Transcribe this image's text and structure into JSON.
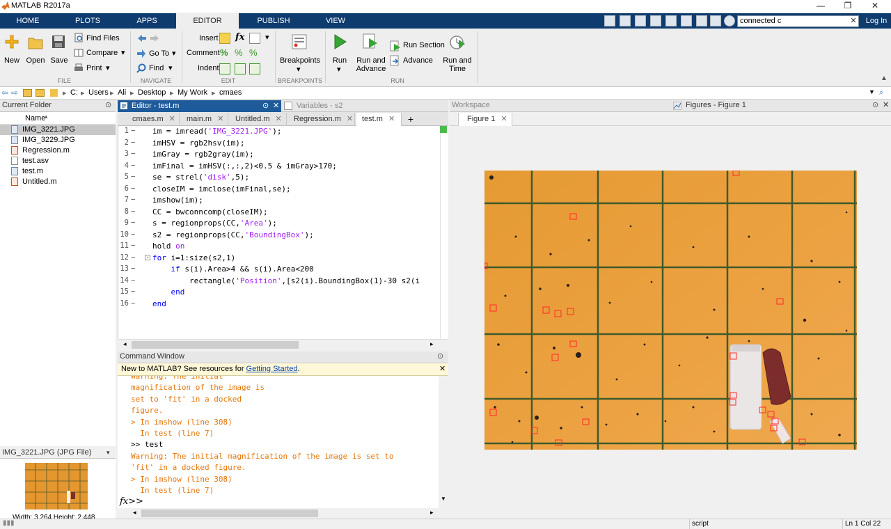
{
  "window": {
    "title": "MATLAB R2017a",
    "minimize": "—",
    "maximize": "❐",
    "close": "✕"
  },
  "ribbon_tabs": [
    "HOME",
    "PLOTS",
    "APPS",
    "EDITOR",
    "PUBLISH",
    "VIEW"
  ],
  "search": {
    "value": "connected c",
    "clear": "✕"
  },
  "login": "Log In",
  "toolstrip": {
    "file": {
      "new": "New",
      "open": "Open",
      "save": "Save",
      "find_files": "Find Files",
      "compare": "Compare",
      "print": "Print",
      "group": "FILE"
    },
    "navigate": {
      "go_to": "Go To",
      "find": "Find",
      "group": "NAVIGATE"
    },
    "edit": {
      "insert": "Insert",
      "comment": "Comment",
      "indent": "Indent",
      "fx": "fx",
      "group": "EDIT"
    },
    "breakpoints": {
      "label": "Breakpoints",
      "group": "BREAKPOINTS"
    },
    "run": {
      "run": "Run",
      "run_and_advance": [
        "Run and",
        "Advance"
      ],
      "run_section": "Run Section",
      "advance": "Advance",
      "run_and_time": [
        "Run and",
        "Time"
      ],
      "group": "RUN"
    }
  },
  "address": {
    "path": [
      "C:",
      "Users",
      "Ali",
      "Desktop",
      "My Work",
      "cmaes"
    ]
  },
  "current_folder": {
    "title": "Current Folder",
    "column": "Name",
    "files": [
      "IMG_3221.JPG",
      "IMG_3229.JPG",
      "Regression.m",
      "test.asv",
      "test.m",
      "Untitled.m"
    ],
    "selected_index": 0,
    "details_title": "IMG_3221.JPG  (JPG File)",
    "details_size": "Width: 3,264 Height: 2,448"
  },
  "editor": {
    "title": "Editor - test.m",
    "variables_title": "Variables - s2",
    "tabs": [
      "cmaes.m",
      "main.m",
      "Untitled.m",
      "Regression.m",
      "test.m"
    ],
    "active_tab": 4,
    "add_tab": "+",
    "lines": [
      [
        {
          "t": "im = imread("
        },
        {
          "t": "'IMG_3221.JPG'",
          "c": "str"
        },
        {
          "t": ");"
        }
      ],
      [
        {
          "t": "imHSV = rgb2hsv(im);"
        }
      ],
      [
        {
          "t": "imGray = rgb2gray(im);"
        }
      ],
      [
        {
          "t": "imFinal = imHSV(:,:,2)<0.5 & imGray>170;"
        }
      ],
      [
        {
          "t": "se = strel("
        },
        {
          "t": "'disk'",
          "c": "str"
        },
        {
          "t": ",5);"
        }
      ],
      [
        {
          "t": "closeIM = imclose(imFinal,se);"
        }
      ],
      [
        {
          "t": "imshow(im);"
        }
      ],
      [
        {
          "t": "CC = bwconncomp(closeIM);"
        }
      ],
      [
        {
          "t": "s = regionprops(CC,"
        },
        {
          "t": "'Area'",
          "c": "str"
        },
        {
          "t": ");"
        }
      ],
      [
        {
          "t": "s2 = regionprops(CC,"
        },
        {
          "t": "'BoundingBox'",
          "c": "str"
        },
        {
          "t": ");"
        }
      ],
      [
        {
          "t": "hold "
        },
        {
          "t": "on",
          "c": "str"
        }
      ],
      [
        {
          "t": "for",
          "c": "kw"
        },
        {
          "t": " i=1:size(s2,1)"
        }
      ],
      [
        {
          "t": "    "
        },
        {
          "t": "if",
          "c": "kw"
        },
        {
          "t": " s(i).Area>4 && s(i).Area<200"
        }
      ],
      [
        {
          "t": "        rectangle("
        },
        {
          "t": "'Position'",
          "c": "str"
        },
        {
          "t": ",[s2(i).BoundingBox(1)-30 s2(i"
        }
      ],
      [
        {
          "t": "    "
        },
        {
          "t": "end",
          "c": "kw"
        }
      ],
      [
        {
          "t": "end",
          "c": "kw"
        }
      ]
    ]
  },
  "command_window": {
    "title": "Command Window",
    "notice_prefix": "New to MATLAB? See resources for ",
    "notice_link": "Getting Started",
    "notice_suffix": ".",
    "lines": [
      {
        "t": "Warning: The initial",
        "c": "warn"
      },
      {
        "t": "magnification of the image is",
        "c": "warn"
      },
      {
        "t": "set to 'fit' in a docked",
        "c": "warn"
      },
      {
        "t": "figure.",
        "c": "warn"
      },
      {
        "t": "> In imshow (line 308)",
        "c": "warn"
      },
      {
        "t": "  In test (line 7)",
        "c": "warn"
      },
      {
        "t": ">> test",
        "c": "blk"
      },
      {
        "t": "Warning: The initial magnification of the image is set to",
        "c": "warn"
      },
      {
        "t": "'fit' in a docked figure.",
        "c": "warn"
      },
      {
        "t": "> In imshow (line 308)",
        "c": "warn"
      },
      {
        "t": "  In test (line 7)",
        "c": "warn"
      }
    ],
    "prompt": "fx>>"
  },
  "workspace": {
    "title": "Workspace"
  },
  "figure": {
    "title": "Figures - Figure 1",
    "tab": "Figure 1"
  },
  "status": {
    "mode": "script",
    "position": "Ln  1   Col  22"
  },
  "colors": {
    "ribbon_bg": "#0f3c6e",
    "editor_header": "#1e5b9a",
    "warning": "#e3760a",
    "keyword": "#0000ff",
    "string": "#a020f0"
  }
}
